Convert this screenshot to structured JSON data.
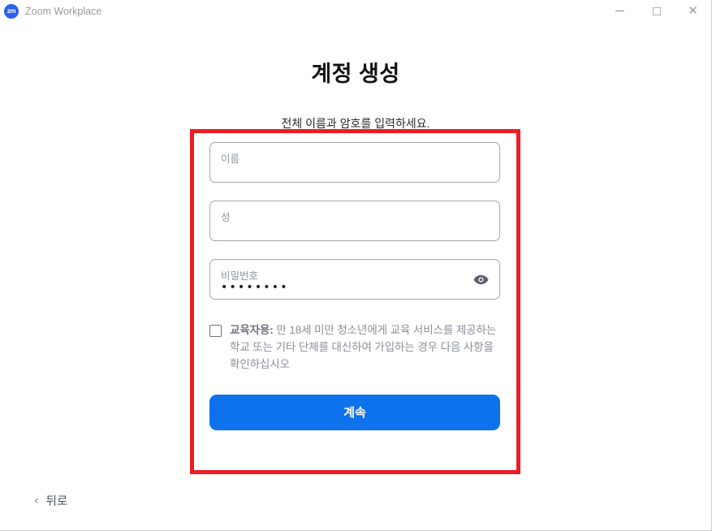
{
  "window": {
    "app_title": "Zoom Workplace",
    "logo_text": "zm",
    "controls": {
      "minimize": "—",
      "maximize": "□",
      "close": "✕"
    }
  },
  "page": {
    "title": "계정 생성",
    "subtitle": "전체 이름과 암호를 입력하세요."
  },
  "form": {
    "first_name": {
      "placeholder": "이름",
      "value": ""
    },
    "last_name": {
      "placeholder": "성",
      "value": ""
    },
    "password": {
      "placeholder": "비밀번호",
      "value": "••••••••",
      "toggle_icon": "eye-icon"
    },
    "edu_consent": {
      "checked": false,
      "label_bold": "교육자용:",
      "label_rest": " 만 18세 미만 청소년에게 교육 서비스를 제공하는 학교 또는 기타 단체를 대신하여 가입하는 경우 다음 사항을 확인하십시오"
    },
    "continue_label": "계속"
  },
  "footer": {
    "back_label": "뒤로",
    "back_icon": "‹"
  },
  "annotation": {
    "color": "#ed1c24"
  },
  "colors": {
    "accent": "#0e72ed",
    "annotation_red": "#ed1c24",
    "placeholder_gray": "#8f949d",
    "body_text": "#131313"
  }
}
